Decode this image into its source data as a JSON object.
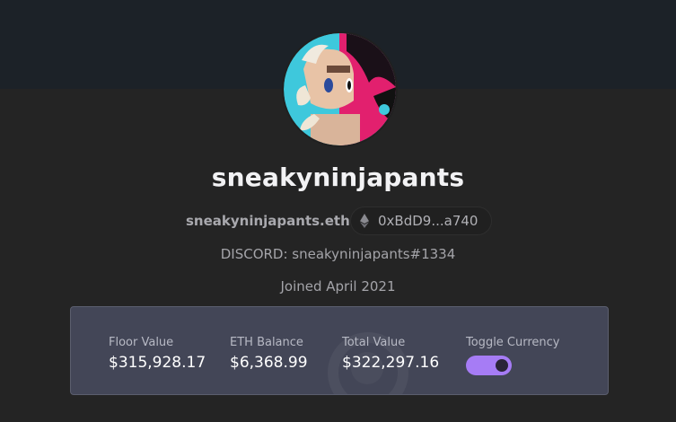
{
  "profile": {
    "username": "sneakyninjapants",
    "ens": "sneakyninjapants.eth",
    "address": "0xBdD9...a740",
    "discord": "DISCORD: sneakyninjapants#1334",
    "joined": "Joined April 2021",
    "avatar_icon": "profile-avatar"
  },
  "stats": {
    "floor_label": "Floor Value",
    "floor_value": "$315,928.17",
    "eth_label": "ETH Balance",
    "eth_value": "$6,368.99",
    "total_label": "Total Value",
    "total_value": "$322,297.16",
    "toggle_label": "Toggle Currency",
    "toggle_on": true
  },
  "colors": {
    "background": "#242424",
    "banner": "#1c2228",
    "stats_panel": "#434657",
    "toggle_accent": "#a67cf5"
  },
  "icons": {
    "address": "ethereum-icon"
  }
}
